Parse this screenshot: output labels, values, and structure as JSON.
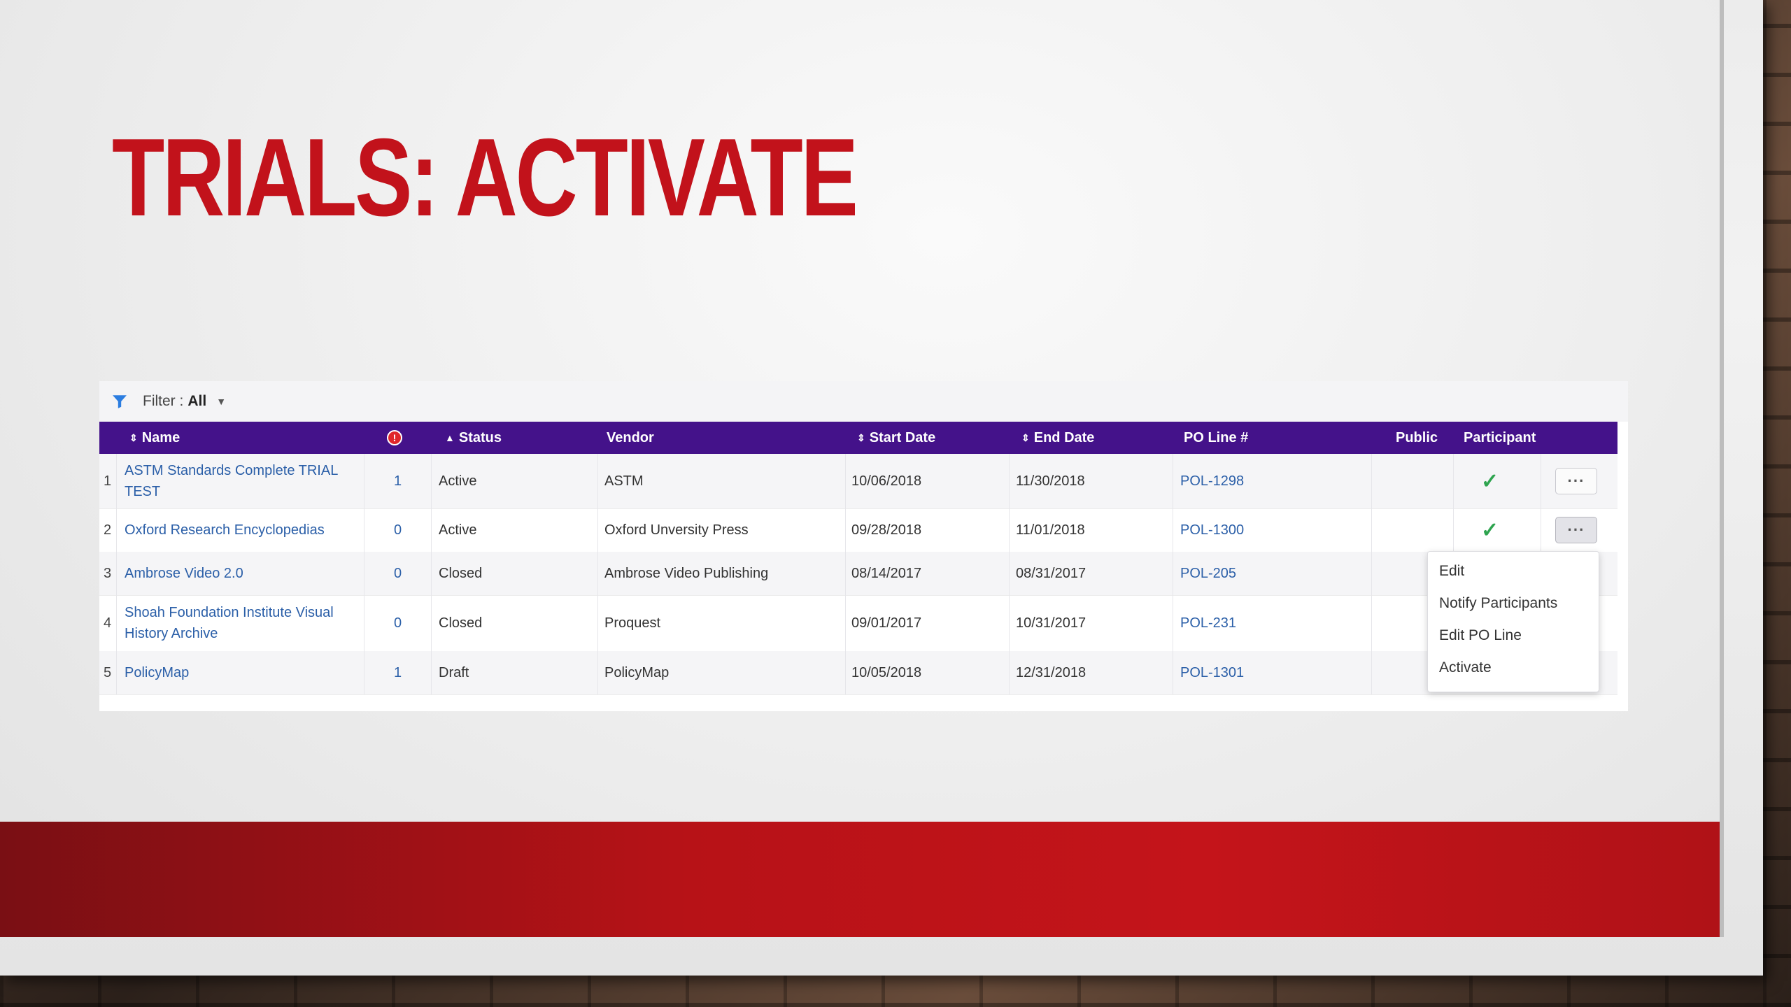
{
  "slide": {
    "title": "TRIALS: ACTIVATE"
  },
  "filter": {
    "label": "Filter :",
    "value": "All"
  },
  "columns": {
    "name": "Name",
    "status": "Status",
    "vendor": "Vendor",
    "start_date": "Start Date",
    "end_date": "End Date",
    "po_line": "PO Line #",
    "public": "Public",
    "participant": "Participant"
  },
  "rows": [
    {
      "index": "1",
      "name_line1": "ASTM Standards Complete TRIAL",
      "name_line2": "TEST",
      "alerts": "1",
      "status": "Active",
      "vendor": "ASTM",
      "start": "10/06/2018",
      "end": "11/30/2018",
      "po": "POL-1298",
      "participant": "✓"
    },
    {
      "index": "2",
      "name_line1": "Oxford Research Encyclopedias",
      "name_line2": "",
      "alerts": "0",
      "status": "Active",
      "vendor": "Oxford Unversity Press",
      "start": "09/28/2018",
      "end": "11/01/2018",
      "po": "POL-1300",
      "participant": "✓"
    },
    {
      "index": "3",
      "name_line1": "Ambrose Video 2.0",
      "name_line2": "",
      "alerts": "0",
      "status": "Closed",
      "vendor": "Ambrose Video Publishing",
      "start": "08/14/2017",
      "end": "08/31/2017",
      "po": "POL-205",
      "participant": ""
    },
    {
      "index": "4",
      "name_line1": "Shoah Foundation Institute Visual",
      "name_line2": "History Archive",
      "alerts": "0",
      "status": "Closed",
      "vendor": "Proquest",
      "start": "09/01/2017",
      "end": "10/31/2017",
      "po": "POL-231",
      "participant": ""
    },
    {
      "index": "5",
      "name_line1": "PolicyMap",
      "name_line2": "",
      "alerts": "1",
      "status": "Draft",
      "vendor": "PolicyMap",
      "start": "10/05/2018",
      "end": "12/31/2018",
      "po": "POL-1301",
      "participant": ""
    }
  ],
  "row_menu": {
    "button_label": "···",
    "items": [
      "Edit",
      "Notify Participants",
      "Edit PO Line",
      "Activate"
    ]
  },
  "colors": {
    "title": "#c2121b",
    "header": "#44128a",
    "link": "#2b5fa8",
    "check": "#2ea44f"
  }
}
